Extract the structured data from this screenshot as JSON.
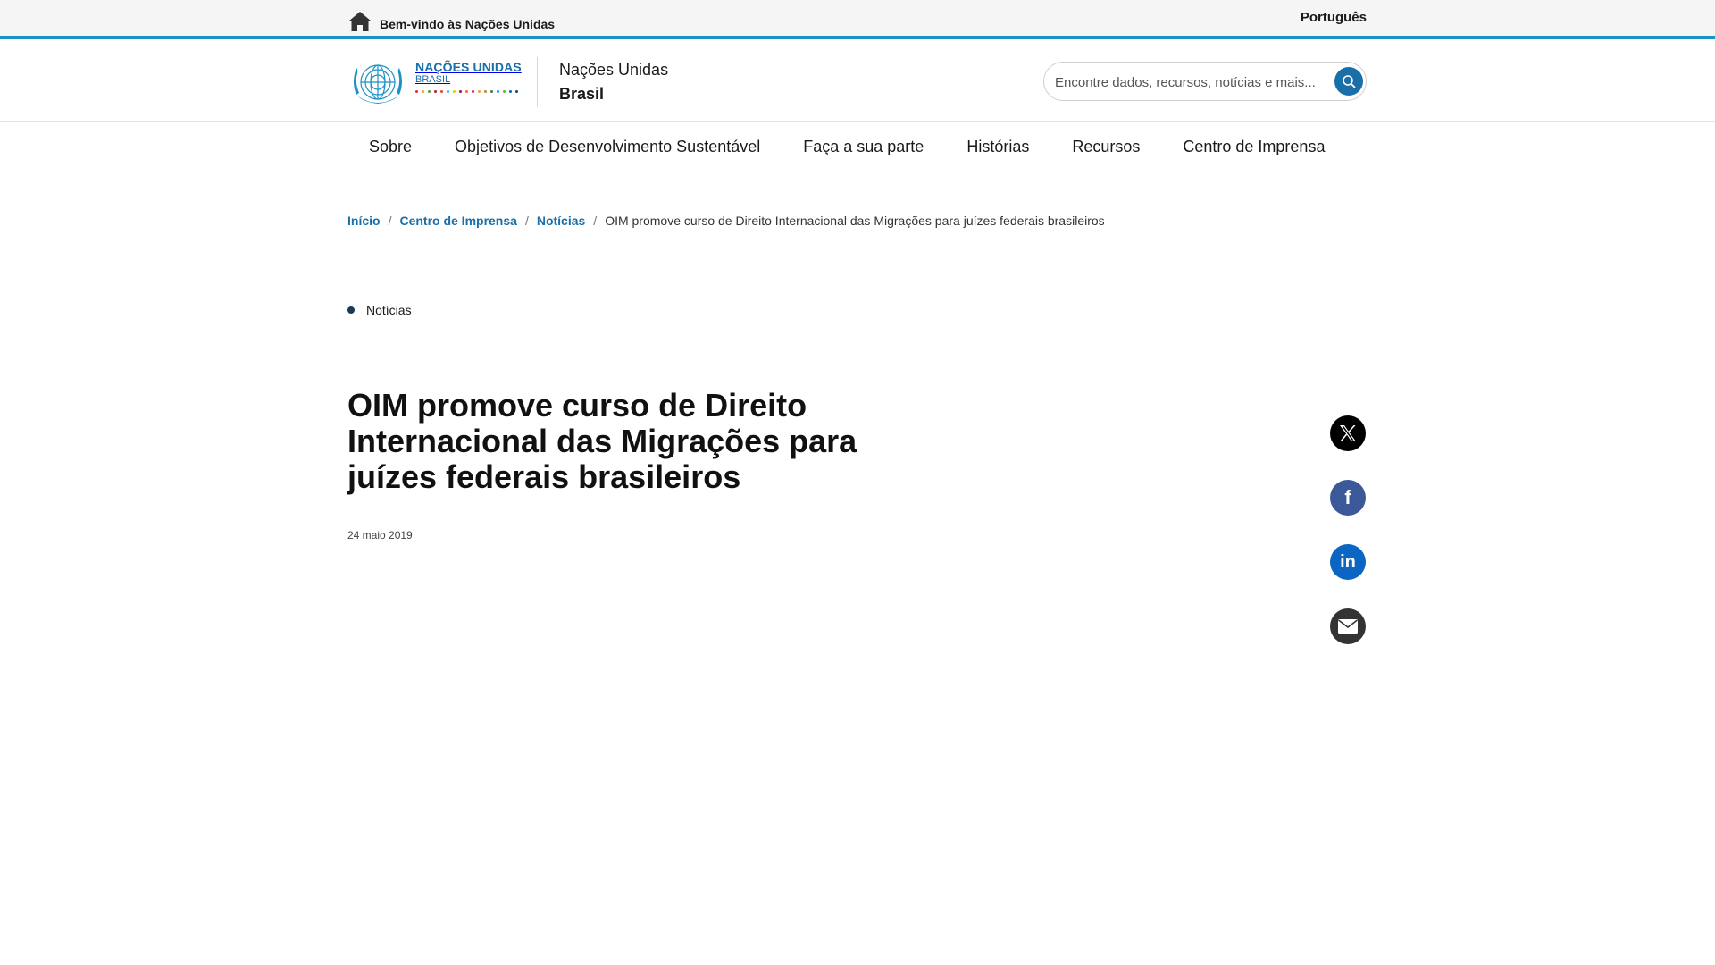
{
  "topbar": {
    "welcome": "Bem-vindo às Nações Unidas",
    "language": "Português"
  },
  "header": {
    "logo_line1": "NAÇÕES UNIDAS",
    "logo_line2": "BRASIL",
    "site_name_line1": "Nações Unidas",
    "site_name_line2": "Brasil",
    "search_placeholder": "Encontre dados, recursos, notícias e mais..."
  },
  "nav": {
    "items": [
      {
        "label": "Sobre"
      },
      {
        "label": "Objetivos de Desenvolvimento Sustentável"
      },
      {
        "label": "Faça a sua parte"
      },
      {
        "label": "Histórias"
      },
      {
        "label": "Recursos"
      },
      {
        "label": "Centro de Imprensa"
      }
    ]
  },
  "breadcrumb": {
    "items": [
      "Início",
      "Centro de Imprensa",
      "Notícias"
    ],
    "separator": "/",
    "current": "OIM promove curso de Direito Internacional das Migrações para juízes federais brasileiros"
  },
  "article": {
    "category": "Notícias",
    "title": "OIM promove curso de Direito Internacional das Migrações para juízes federais brasileiros",
    "date": "24 maio 2019"
  },
  "social": {
    "icons": [
      "x-icon",
      "facebook-icon",
      "linkedin-icon",
      "email-icon"
    ]
  },
  "colors": {
    "accent": "#1a92c6",
    "link": "#1a6fa8",
    "facebook": "#3b5998",
    "linkedin": "#0a66c2",
    "sdg_dots": [
      "#e5243b",
      "#dda63a",
      "#4c9f38",
      "#c5192d",
      "#ff3a21",
      "#26bde2",
      "#fcc30b",
      "#a21942",
      "#fd6925",
      "#dd1367",
      "#fd9d24",
      "#bf8b2e",
      "#3f7e44",
      "#0a97d9",
      "#56c02b",
      "#00689d",
      "#19486a"
    ]
  }
}
